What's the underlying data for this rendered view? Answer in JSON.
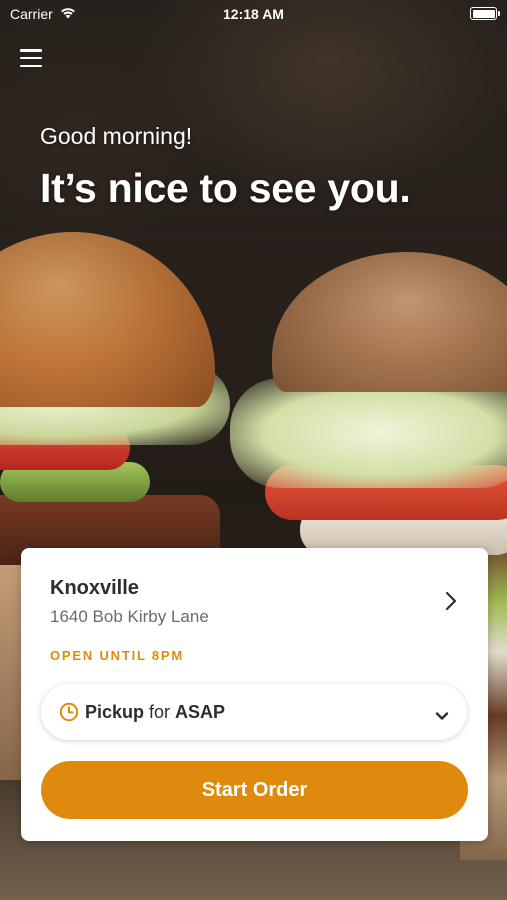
{
  "status_bar": {
    "carrier": "Carrier",
    "time": "12:18 AM",
    "wifi_icon": "wifi-icon",
    "battery_icon": "battery-icon"
  },
  "menu": {
    "icon": "hamburger-menu-icon"
  },
  "hero": {
    "greeting": "Good morning!",
    "headline": "It’s nice to see you."
  },
  "store": {
    "name": "Knoxville",
    "address": "1640 Bob Kirby Lane",
    "hours": "OPEN UNTIL 8PM",
    "chevron_icon": "chevron-right-icon"
  },
  "order_options": {
    "mode": "Pickup",
    "connector": "for",
    "time": "ASAP",
    "clock_icon": "clock-icon",
    "dropdown_icon": "chevron-down-icon"
  },
  "actions": {
    "start_order_label": "Start Order"
  },
  "colors": {
    "accent": "#df8a0d",
    "card_background": "#ffffff",
    "text_primary": "#2d2d2d",
    "text_secondary": "#6b6b6b"
  }
}
